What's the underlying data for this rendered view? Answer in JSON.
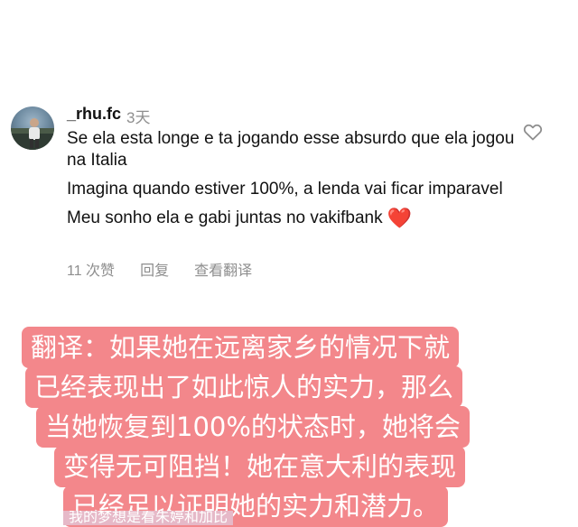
{
  "comment": {
    "username": "_rhu.fc",
    "time": "3天",
    "paragraphs": [
      "Se ela esta longe e ta jogando esse absurdo que ela jogou na Italia",
      "Imagina quando estiver 100%, a lenda vai ficar imparavel",
      "Meu sonho ela e gabi juntas no vakifbank"
    ],
    "heart_emoji": "❤️",
    "likes": "11 次赞",
    "reply": "回复",
    "view_translation": "查看翻译"
  },
  "overlay": {
    "lines": [
      "翻译：如果她在远离家乡的情况下就",
      "已经表现出了如此惊人的实力，那么",
      "当她恢复到100%的状态时，她将会",
      "变得无可阻挡！她在意大利的表现",
      "已经足以证明她的实力和潜力。"
    ],
    "bottom_line": "我的梦想是看朱婷和加比"
  },
  "colors": {
    "overlay_bg": "#f3878b",
    "overlay_bottom_bg": "#e6b9c8",
    "meta_gray": "#8e8e8e"
  },
  "icons": {
    "like": "heart-outline-icon"
  }
}
